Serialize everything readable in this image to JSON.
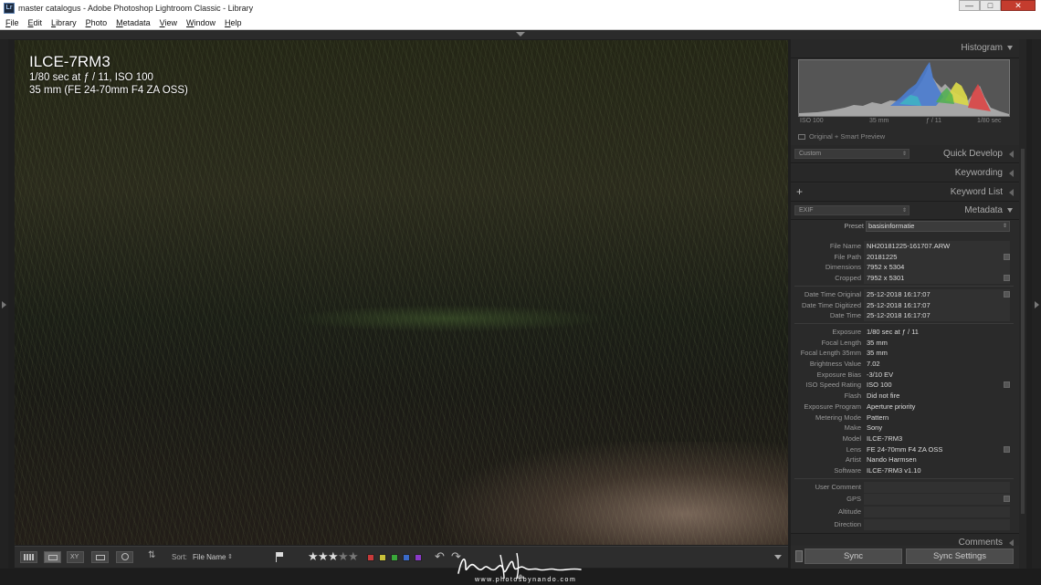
{
  "window": {
    "title": "master catalogus - Adobe Photoshop Lightroom Classic - Library",
    "app_icon": "Lr"
  },
  "menu": [
    "File",
    "Edit",
    "Library",
    "Photo",
    "Metadata",
    "View",
    "Window",
    "Help"
  ],
  "photo_overlay": {
    "model": "ILCE-7RM3",
    "line1": "1/80 sec at ƒ / 11, ISO 100",
    "line2": "35 mm (FE 24-70mm F4 ZA OSS)"
  },
  "histogram": {
    "title": "Histogram",
    "iso": "ISO 100",
    "focal": "35 mm",
    "aperture": "ƒ / 11",
    "shutter": "1/80 sec",
    "smart_preview": "Original + Smart Preview"
  },
  "panels": {
    "quick_develop": "Quick Develop",
    "quick_develop_preset": "Custom",
    "keywording": "Keywording",
    "keyword_list": "Keyword List",
    "metadata": "Metadata",
    "metadata_view": "EXIF",
    "comments": "Comments"
  },
  "metadata": {
    "preset_label": "Preset",
    "preset_value": "basisinformatie",
    "rows": [
      {
        "k": "File Name",
        "v": "NH20181225-161707.ARW"
      },
      {
        "k": "File Path",
        "v": "20181225"
      },
      {
        "k": "Dimensions",
        "v": "7952 x 5304"
      },
      {
        "k": "Cropped",
        "v": "7952 x 5301"
      },
      {
        "k": "Date Time Original",
        "v": "25-12-2018 16:17:07"
      },
      {
        "k": "Date Time Digitized",
        "v": "25-12-2018 16:17:07"
      },
      {
        "k": "Date Time",
        "v": "25-12-2018 16:17:07"
      },
      {
        "k": "Exposure",
        "v": "1/80 sec at ƒ / 11"
      },
      {
        "k": "Focal Length",
        "v": "35 mm"
      },
      {
        "k": "Focal Length 35mm",
        "v": "35 mm"
      },
      {
        "k": "Brightness Value",
        "v": "7.02"
      },
      {
        "k": "Exposure Bias",
        "v": "-3/10 EV"
      },
      {
        "k": "ISO Speed Rating",
        "v": "ISO 100"
      },
      {
        "k": "Flash",
        "v": "Did not fire"
      },
      {
        "k": "Exposure Program",
        "v": "Aperture priority"
      },
      {
        "k": "Metering Mode",
        "v": "Pattern"
      },
      {
        "k": "Make",
        "v": "Sony"
      },
      {
        "k": "Model",
        "v": "ILCE-7RM3"
      },
      {
        "k": "Lens",
        "v": "FE 24-70mm F4 ZA OSS"
      },
      {
        "k": "Artist",
        "v": "Nando Harmsen"
      },
      {
        "k": "Software",
        "v": "ILCE-7RM3 v1.10"
      },
      {
        "k": "User Comment",
        "v": ""
      },
      {
        "k": "GPS",
        "v": ""
      },
      {
        "k": "Altitude",
        "v": ""
      },
      {
        "k": "Direction",
        "v": ""
      }
    ]
  },
  "toolbar": {
    "sort_label": "Sort:",
    "sort_value": "File Name",
    "rating": 3,
    "rating_max": 5,
    "color_labels": [
      "#c83a3a",
      "#c8c13a",
      "#3aa83a",
      "#3a6ac8",
      "#8a3ac8"
    ]
  },
  "sync": {
    "sync_label": "Sync",
    "sync_settings_label": "Sync Settings"
  },
  "watermark": {
    "signature": "Nando Harmsen",
    "url": "www.photosbynando.com"
  }
}
